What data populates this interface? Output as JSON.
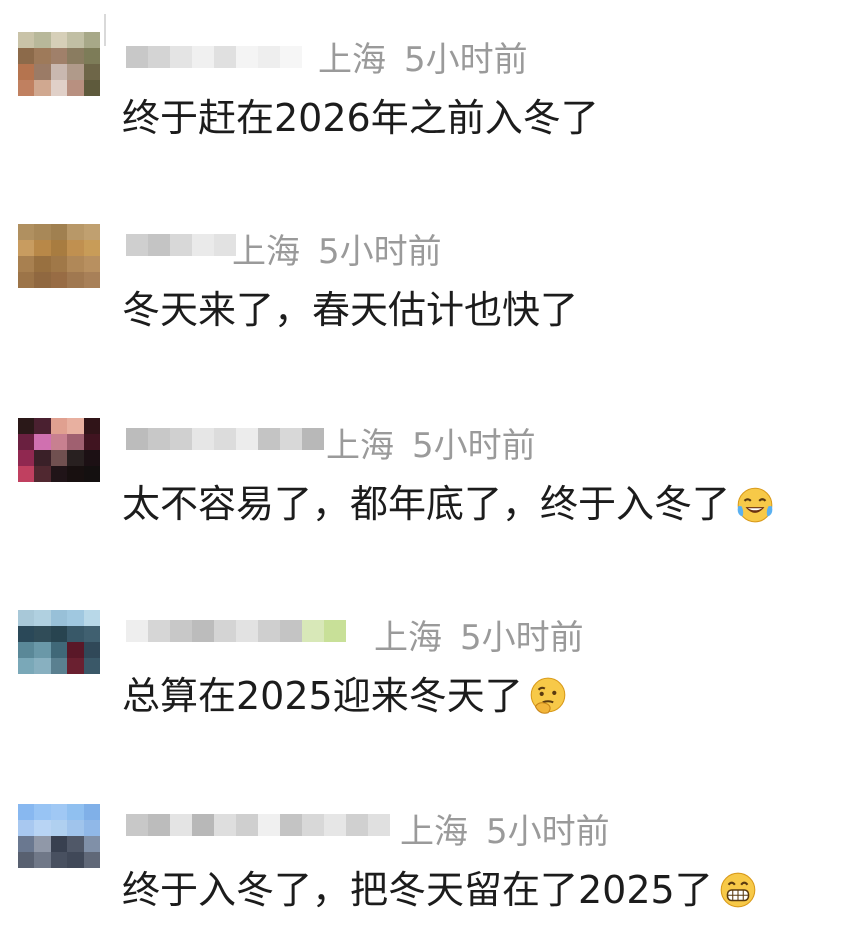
{
  "comments": [
    {
      "location": "上海",
      "time": "5小时前",
      "text": "终于赶在2026年之前入冬了",
      "emoji": ""
    },
    {
      "location": "上海",
      "time": "5小时前",
      "text": "冬天来了，春天估计也快了",
      "emoji": ""
    },
    {
      "location": "上海",
      "time": "5小时前",
      "text": "太不容易了，都年底了，终于入冬了",
      "emoji": "crying-laughing-emoji"
    },
    {
      "location": "上海",
      "time": "5小时前",
      "text": "总算在2025迎来冬天了",
      "emoji": "thinking-emoji"
    },
    {
      "location": "上海",
      "time": "5小时前",
      "text": "终于入冬了，把冬天留在了2025了",
      "emoji": "grinning-emoji"
    }
  ],
  "colors": {
    "meta_text": "#9a9a9a",
    "body_text": "#1c1c1c"
  }
}
